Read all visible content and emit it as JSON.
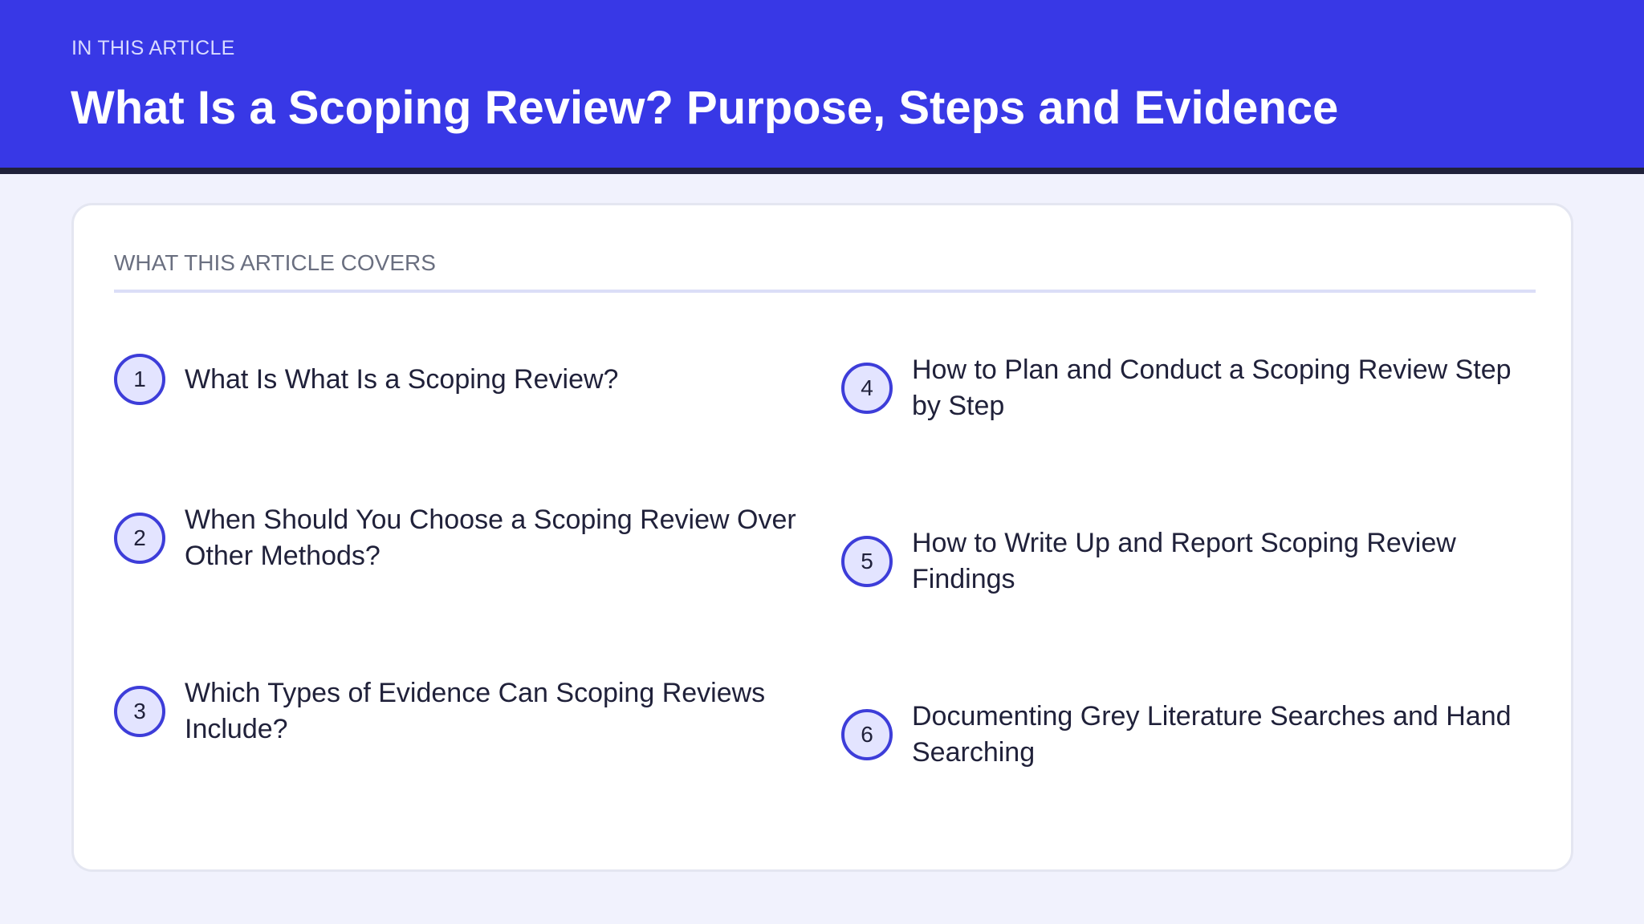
{
  "header": {
    "eyebrow": "IN THIS ARTICLE",
    "title": "What Is a Scoping Review? Purpose, Steps and Evidence"
  },
  "card": {
    "heading": "WHAT THIS ARTICLE COVERS",
    "items": [
      {
        "number": "1",
        "label": "What Is What Is a Scoping Review?"
      },
      {
        "number": "2",
        "label": "When Should You Choose a Scoping Review Over Other Methods?"
      },
      {
        "number": "3",
        "label": "Which Types of Evidence Can Scoping Reviews Include?"
      },
      {
        "number": "4",
        "label": "How to Plan and Conduct a Scoping Review Step by Step"
      },
      {
        "number": "5",
        "label": "How to Write Up and Report Scoping Review Findings"
      },
      {
        "number": "6",
        "label": "Documenting Grey Literature Searches and Hand Searching"
      }
    ]
  },
  "colors": {
    "header_bg": "#3838e6",
    "header_rule": "#20213a",
    "page_bg": "#f1f2fd",
    "accent": "#3d3dd9",
    "badge_fill": "#e3e4ff",
    "text": "#20213a"
  }
}
